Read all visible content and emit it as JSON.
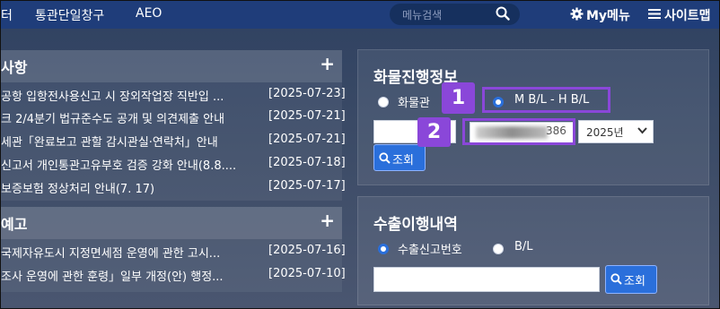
{
  "nav": {
    "items": [
      "터",
      "통관단일창구",
      "AEO"
    ],
    "search_placeholder": "메뉴검색",
    "mymenu_label": "My메뉴",
    "sitemap_label": "사이트맵"
  },
  "notice": {
    "title": "사항",
    "plus": "+",
    "rows": [
      {
        "title": "공항 입항전사용신고 시 장외작업장 직반입 ...",
        "date": "[2025-07-23]"
      },
      {
        "title": "크 2/4분기 법규준수도 공개 및 의견제출 안내",
        "date": "[2025-07-21]"
      },
      {
        "title": "세관「완료보고 관할 감시관실·연락처」안내",
        "date": "[2025-07-21]"
      },
      {
        "title": "신고서 개인통관고유부호 검증 강화 안내(8.8....",
        "date": "[2025-07-18]"
      },
      {
        "title": "보증보험 정상처리 안내(7. 17)",
        "date": "[2025-07-17]"
      }
    ]
  },
  "preannounce": {
    "title": "예고",
    "plus": "+",
    "rows": [
      {
        "title": "국제자유도시 지정면세점 운영에 관한 고시...",
        "date": "[2025-07-16]"
      },
      {
        "title": "조사 운영에 관한 훈령」일부 개정(안) 행정...",
        "date": "[2025-07-10]"
      }
    ]
  },
  "cargo": {
    "title": "화물진행정보",
    "radio1_label": "화물관",
    "radio2_label": "M B/L - H B/L",
    "input_value_tail": "386",
    "year": "2025년",
    "search_btn": "조회"
  },
  "export": {
    "title": "수출이행내역",
    "radio1_label": "수출신고번호",
    "radio2_label": "B/L",
    "search_btn": "조회"
  },
  "annotations": {
    "badge1": "1",
    "badge2": "2",
    "accent": "#8a47d9"
  }
}
